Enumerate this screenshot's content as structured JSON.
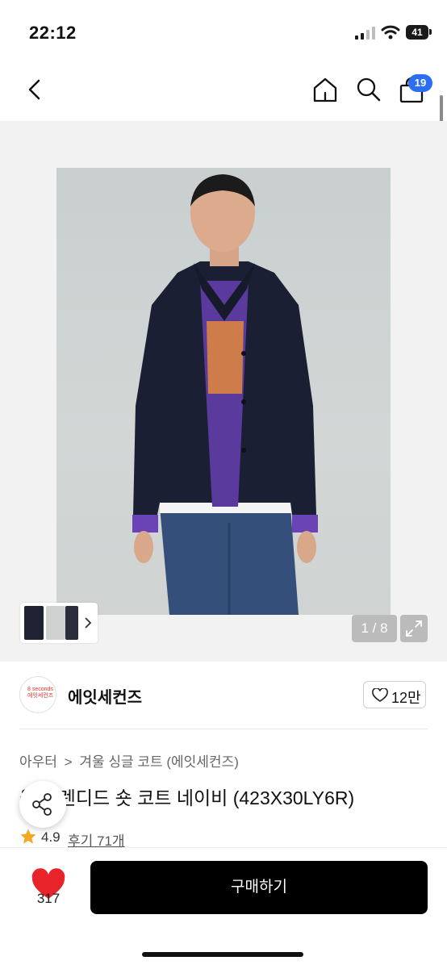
{
  "status_bar": {
    "time": "22:12",
    "battery_level": "41"
  },
  "nav": {
    "cart_badge": "19",
    "icons": [
      "chevron-left-icon",
      "home-icon",
      "search-icon",
      "shopping-bag-icon"
    ]
  },
  "gallery": {
    "pager": "1 / 8"
  },
  "brand": {
    "logo_text_1": "8 seconds",
    "logo_text_2": "에잇세컨즈",
    "name": "에잇세컨즈",
    "likes": "12만"
  },
  "product": {
    "breadcrumb": [
      "아우터",
      "겨울 싱글 코트 (에잇세컨즈)"
    ],
    "breadcrumb_sep": ">",
    "title": "울 블렌디드 숏 코트 네이비 (423X30LY6R)",
    "rating": "4.9",
    "reviews": "후기 71개"
  },
  "bottom": {
    "wish_count": "317",
    "buy_label": "구매하기"
  },
  "colors": {
    "accent_badge": "#2b6ef2",
    "heart": "#e8232a",
    "star": "#f5a623",
    "buy_button": "#000000"
  }
}
